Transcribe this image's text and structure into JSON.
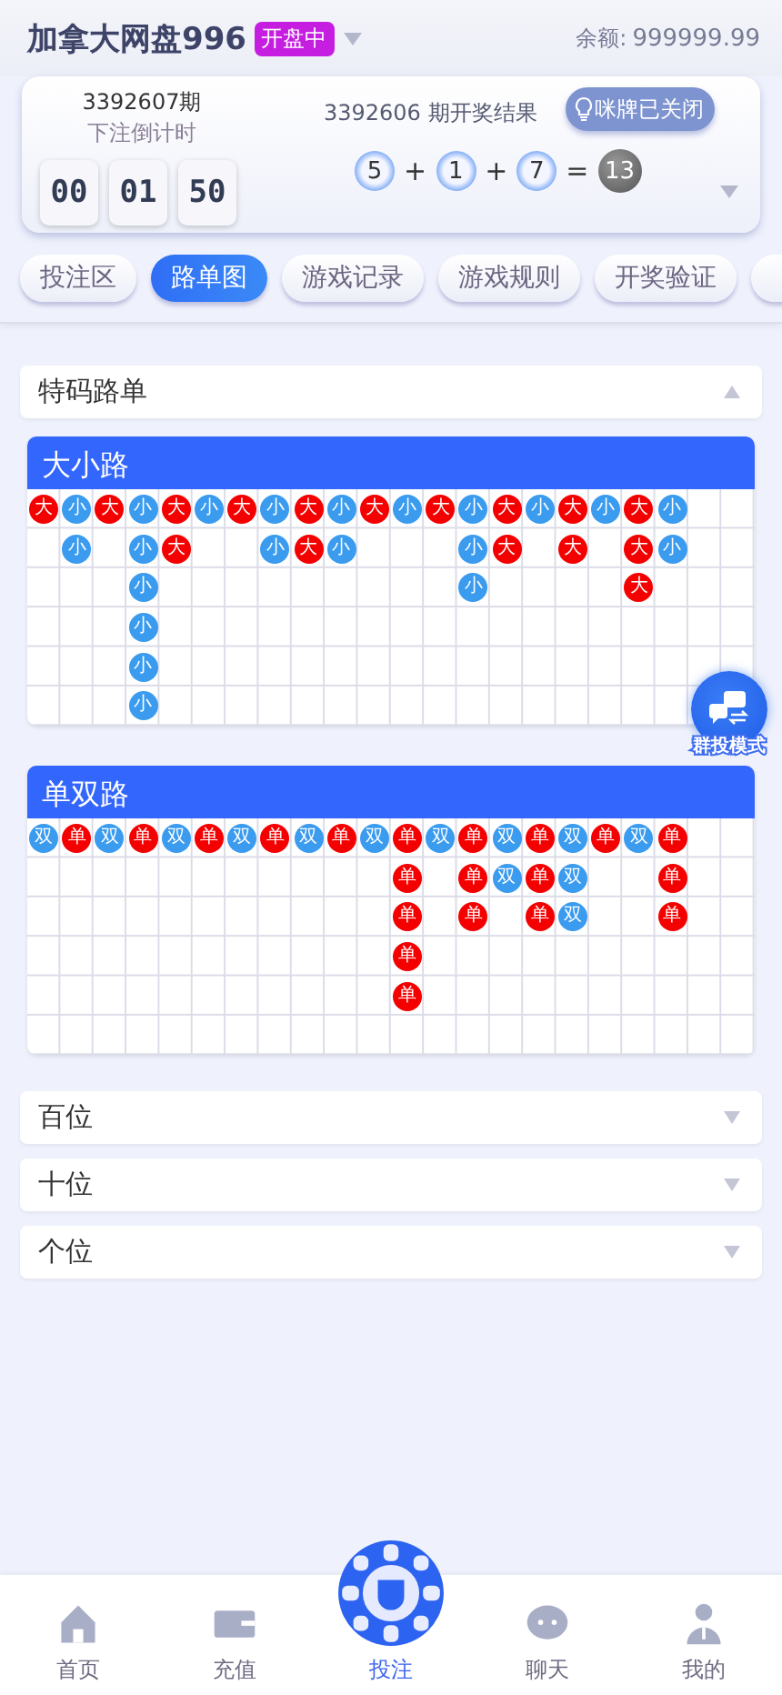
{
  "header": {
    "title": "加拿大网盘996",
    "status": "开盘中",
    "balance_label": "余额:",
    "balance": "999999.99"
  },
  "draw": {
    "next_issue": "3392607期",
    "countdown_label": "下注倒计时",
    "countdown": [
      "00",
      "01",
      "50"
    ],
    "last_result_label": "3392606 期开奖结果",
    "squeeze_button": "咪牌已关闭",
    "numbers": [
      "5",
      "1",
      "7"
    ],
    "operators": [
      "+",
      "+",
      "="
    ],
    "sum": "13"
  },
  "tabs": [
    {
      "label": "投注区",
      "selected": false
    },
    {
      "label": "路单图",
      "selected": true
    },
    {
      "label": "游戏记录",
      "selected": false
    },
    {
      "label": "游戏规则",
      "selected": false
    },
    {
      "label": "开奖验证",
      "selected": false
    }
  ],
  "sections_top": [
    {
      "label": "特码路单",
      "expanded": true
    }
  ],
  "roads": [
    {
      "title": "大小路",
      "columns": [
        [
          {
            "label": "大",
            "color": "#f50000"
          }
        ],
        [
          {
            "label": "小",
            "color": "#3a9bef"
          },
          {
            "label": "小",
            "color": "#3a9bef"
          }
        ],
        [
          {
            "label": "大",
            "color": "#f50000"
          }
        ],
        [
          {
            "label": "小",
            "color": "#3a9bef"
          },
          {
            "label": "小",
            "color": "#3a9bef"
          },
          {
            "label": "小",
            "color": "#3a9bef"
          },
          {
            "label": "小",
            "color": "#3a9bef"
          },
          {
            "label": "小",
            "color": "#3a9bef"
          },
          {
            "label": "小",
            "color": "#3a9bef"
          }
        ],
        [
          {
            "label": "大",
            "color": "#f50000"
          },
          {
            "label": "大",
            "color": "#f50000"
          }
        ],
        [
          {
            "label": "小",
            "color": "#3a9bef"
          }
        ],
        [
          {
            "label": "大",
            "color": "#f50000"
          }
        ],
        [
          {
            "label": "小",
            "color": "#3a9bef"
          },
          {
            "label": "小",
            "color": "#3a9bef"
          }
        ],
        [
          {
            "label": "大",
            "color": "#f50000"
          },
          {
            "label": "大",
            "color": "#f50000"
          }
        ],
        [
          {
            "label": "小",
            "color": "#3a9bef"
          },
          {
            "label": "小",
            "color": "#3a9bef"
          }
        ],
        [
          {
            "label": "大",
            "color": "#f50000"
          }
        ],
        [
          {
            "label": "小",
            "color": "#3a9bef"
          }
        ],
        [
          {
            "label": "大",
            "color": "#f50000"
          }
        ],
        [
          {
            "label": "小",
            "color": "#3a9bef"
          },
          {
            "label": "小",
            "color": "#3a9bef"
          },
          {
            "label": "小",
            "color": "#3a9bef"
          }
        ],
        [
          {
            "label": "大",
            "color": "#f50000"
          },
          {
            "label": "大",
            "color": "#f50000"
          }
        ],
        [
          {
            "label": "小",
            "color": "#3a9bef"
          }
        ],
        [
          {
            "label": "大",
            "color": "#f50000"
          },
          {
            "label": "大",
            "color": "#f50000"
          }
        ],
        [
          {
            "label": "小",
            "color": "#3a9bef"
          }
        ],
        [
          {
            "label": "大",
            "color": "#f50000"
          },
          {
            "label": "大",
            "color": "#f50000"
          },
          {
            "label": "大",
            "color": "#f50000"
          }
        ],
        [
          {
            "label": "小",
            "color": "#3a9bef"
          },
          {
            "label": "小",
            "color": "#3a9bef"
          }
        ]
      ]
    },
    {
      "title": "单双路",
      "columns": [
        [
          {
            "label": "双",
            "color": "#3a9bef"
          }
        ],
        [
          {
            "label": "单",
            "color": "#f50000"
          }
        ],
        [
          {
            "label": "双",
            "color": "#3a9bef"
          }
        ],
        [
          {
            "label": "单",
            "color": "#f50000"
          }
        ],
        [
          {
            "label": "双",
            "color": "#3a9bef"
          }
        ],
        [
          {
            "label": "单",
            "color": "#f50000"
          }
        ],
        [
          {
            "label": "双",
            "color": "#3a9bef"
          }
        ],
        [
          {
            "label": "单",
            "color": "#f50000"
          }
        ],
        [
          {
            "label": "双",
            "color": "#3a9bef"
          }
        ],
        [
          {
            "label": "单",
            "color": "#f50000"
          }
        ],
        [
          {
            "label": "双",
            "color": "#3a9bef"
          }
        ],
        [
          {
            "label": "单",
            "color": "#f50000"
          },
          {
            "label": "单",
            "color": "#f50000"
          },
          {
            "label": "单",
            "color": "#f50000"
          },
          {
            "label": "单",
            "color": "#f50000"
          },
          {
            "label": "单",
            "color": "#f50000"
          }
        ],
        [
          {
            "label": "双",
            "color": "#3a9bef"
          }
        ],
        [
          {
            "label": "单",
            "color": "#f50000"
          },
          {
            "label": "单",
            "color": "#f50000"
          },
          {
            "label": "单",
            "color": "#f50000"
          }
        ],
        [
          {
            "label": "双",
            "color": "#3a9bef"
          },
          {
            "label": "双",
            "color": "#3a9bef"
          }
        ],
        [
          {
            "label": "单",
            "color": "#f50000"
          },
          {
            "label": "单",
            "color": "#f50000"
          },
          {
            "label": "单",
            "color": "#f50000"
          }
        ],
        [
          {
            "label": "双",
            "color": "#3a9bef"
          },
          {
            "label": "双",
            "color": "#3a9bef"
          },
          {
            "label": "双",
            "color": "#3a9bef"
          }
        ],
        [
          {
            "label": "单",
            "color": "#f50000"
          }
        ],
        [
          {
            "label": "双",
            "color": "#3a9bef"
          }
        ],
        [
          {
            "label": "单",
            "color": "#f50000"
          },
          {
            "label": "单",
            "color": "#f50000"
          },
          {
            "label": "单",
            "color": "#f50000"
          }
        ]
      ]
    }
  ],
  "sections": [
    {
      "label": "百位",
      "expanded": false
    },
    {
      "label": "十位",
      "expanded": false
    },
    {
      "label": "个位",
      "expanded": false
    }
  ],
  "float_button": {
    "label": "群投模式"
  },
  "nav": [
    {
      "label": "首页",
      "kind": "home",
      "selected": false
    },
    {
      "label": "充值",
      "kind": "wallet",
      "selected": false
    },
    {
      "label": "投注",
      "kind": "chip",
      "selected": true
    },
    {
      "label": "聊天",
      "kind": "chat",
      "selected": false
    },
    {
      "label": "我的",
      "kind": "user",
      "selected": false
    }
  ]
}
